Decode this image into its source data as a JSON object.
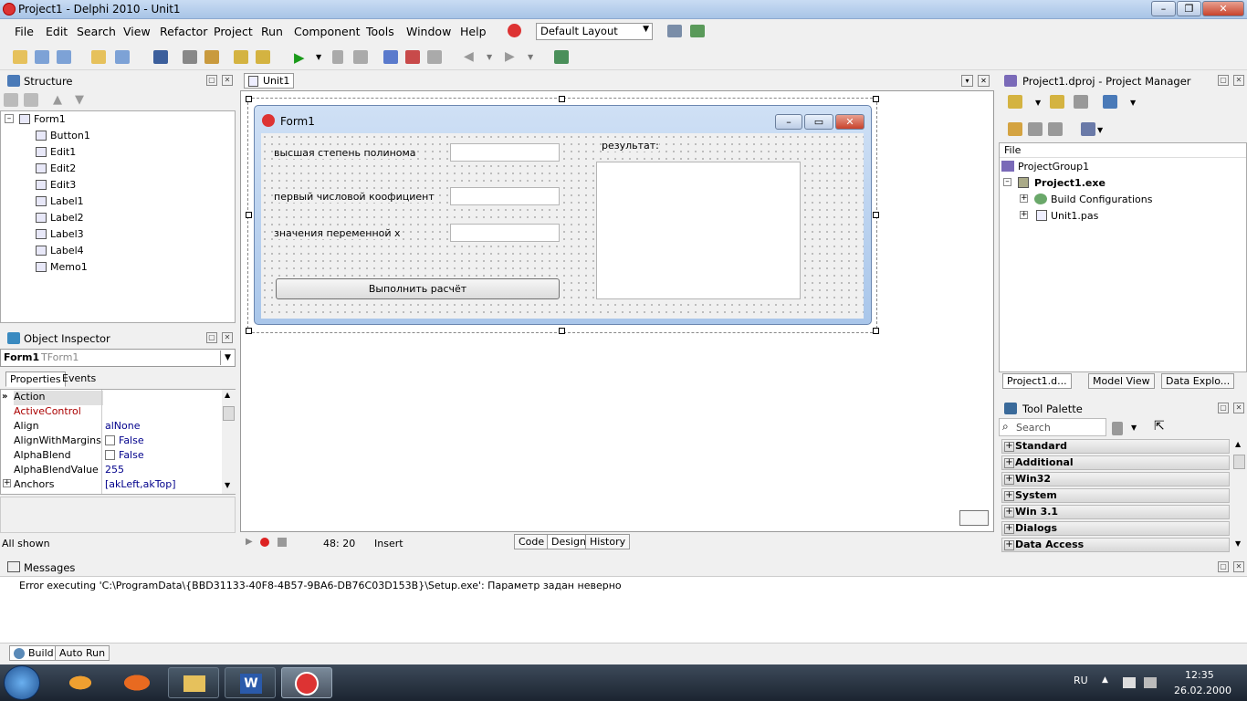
{
  "window": {
    "title": "Project1 - Delphi 2010 - Unit1"
  },
  "menu": [
    "File",
    "Edit",
    "Search",
    "View",
    "Refactor",
    "Project",
    "Run",
    "Component",
    "Tools",
    "Window",
    "Help"
  ],
  "layout_combo": "Default Layout",
  "structure": {
    "title": "Structure",
    "root": "Form1",
    "items": [
      "Button1",
      "Edit1",
      "Edit2",
      "Edit3",
      "Label1",
      "Label2",
      "Label3",
      "Label4",
      "Memo1"
    ]
  },
  "object_inspector": {
    "title": "Object Inspector",
    "object": "Form1",
    "class": "TForm1",
    "tabs": [
      "Properties",
      "Events"
    ],
    "rows": [
      {
        "name": "Action",
        "value": ""
      },
      {
        "name": "ActiveControl",
        "value": ""
      },
      {
        "name": "Align",
        "value": "alNone"
      },
      {
        "name": "AlignWithMargins",
        "value": "False"
      },
      {
        "name": "AlphaBlend",
        "value": "False"
      },
      {
        "name": "AlphaBlendValue",
        "value": "255"
      },
      {
        "name": "Anchors",
        "value": "[akLeft,akTop]"
      }
    ],
    "status": "All shown"
  },
  "editor": {
    "tab": "Unit1",
    "status_pos": "48: 20",
    "status_mode": "Insert",
    "bottom_tabs": [
      "Code",
      "Design",
      "History"
    ]
  },
  "form": {
    "caption": "Form1",
    "label1": "высшая степень полинома",
    "label2": "первый числовой коофициент",
    "label3": "значения переменной x",
    "label4": "результат:",
    "button": "Выполнить расчёт"
  },
  "project_manager": {
    "title": "Project1.dproj - Project Manager",
    "col": "File",
    "group": "ProjectGroup1",
    "exe": "Project1.exe",
    "build": "Build Configurations",
    "unit": "Unit1.pas",
    "tabs": [
      "Project1.d...",
      "Model View",
      "Data Explo..."
    ]
  },
  "tool_palette": {
    "title": "Tool Palette",
    "search": "Search",
    "categories": [
      "Standard",
      "Additional",
      "Win32",
      "System",
      "Win 3.1",
      "Dialogs",
      "Data Access"
    ]
  },
  "messages": {
    "title": "Messages",
    "text": "Error executing 'C:\\ProgramData\\{BBD31133-40F8-4B57-9BA6-DB76C03D153B}\\Setup.exe': Параметр задан неверно",
    "tabs": [
      "Build",
      "Auto Run"
    ]
  },
  "taskbar": {
    "lang": "RU",
    "time": "12:35",
    "date": "26.02.2000"
  }
}
